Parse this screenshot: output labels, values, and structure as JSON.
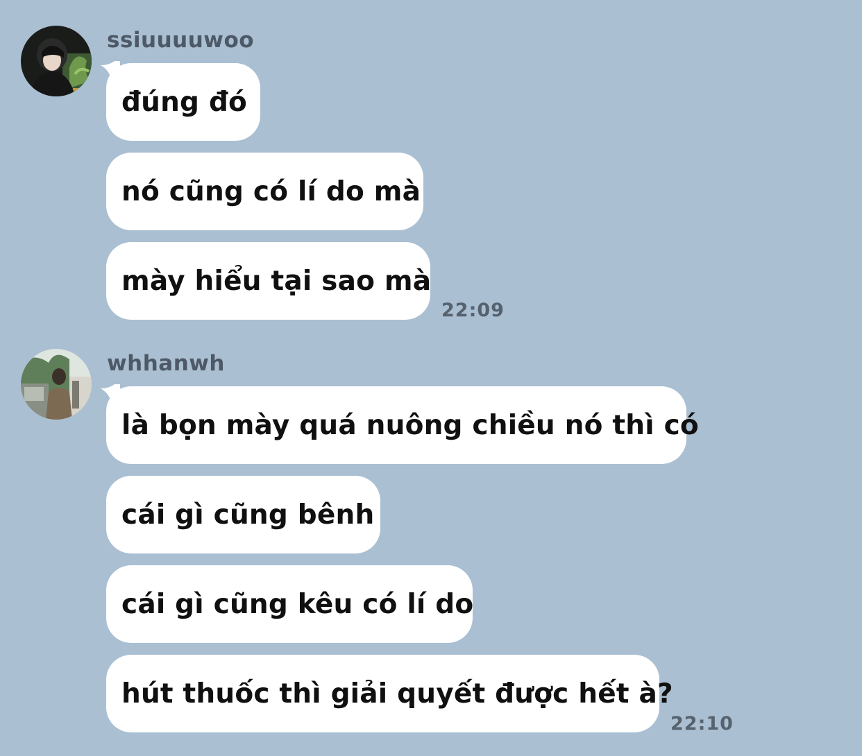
{
  "messages": [
    {
      "sender": "ssiuuuuwoo",
      "bubbles": [
        "đúng đó",
        "nó cũng có lí do mà",
        "mày hiểu tại sao mà"
      ],
      "time": "22:09"
    },
    {
      "sender": "whhanwh",
      "bubbles": [
        "là bọn mày quá nuông chiều nó thì có",
        "cái gì cũng bênh",
        "cái gì cũng kêu có lí do",
        "hút thuốc thì giải quyết được hết à?"
      ],
      "time": "22:10"
    }
  ],
  "colors": {
    "background": "#aabfd2",
    "bubble": "#ffffff",
    "sender_text": "#4d5966",
    "time_text": "#56626e"
  }
}
